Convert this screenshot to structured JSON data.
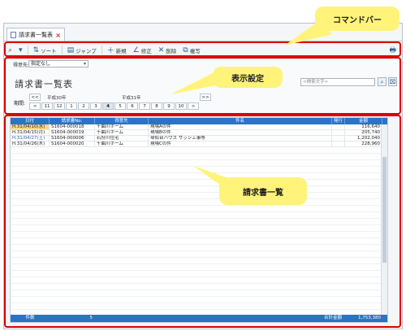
{
  "tab": {
    "title": "請求書一覧表",
    "close": "×"
  },
  "toolbar": {
    "items": [
      {
        "icon": "search-icon",
        "glyph": "⌕",
        "label": ""
      },
      {
        "icon": "dropdown-icon",
        "glyph": "▾",
        "label": ""
      },
      {
        "icon": "sort-icon",
        "glyph": "⇅",
        "label": "ソート"
      },
      {
        "icon": "jump-icon",
        "glyph": "▤",
        "label": "ジャンプ"
      },
      {
        "icon": "new-icon",
        "glyph": "＋",
        "label": "新規"
      },
      {
        "icon": "edit-icon",
        "glyph": "∠",
        "label": "修正"
      },
      {
        "icon": "delete-icon",
        "glyph": "✕",
        "label": "削除"
      },
      {
        "icon": "copy-icon",
        "glyph": "⧉",
        "label": "複写"
      }
    ],
    "print_icon": "🖶"
  },
  "settings": {
    "client_label": "得意先:",
    "client_value": "指定なし",
    "page_title": "請求書一覧表",
    "search_placeholder": "<検索文字>",
    "period_label": "期間:",
    "era_left": "平成30年",
    "era_right": "平成31年",
    "months": [
      "11",
      "12",
      "1",
      "2",
      "3",
      "4",
      "5",
      "6",
      "7",
      "8",
      "9",
      "10"
    ],
    "selected_month": "4",
    "prev": "<<",
    "prev1": "<",
    "next": ">>"
  },
  "grid": {
    "headers": [
      "日付",
      "請求書No.",
      "得意先",
      "件名",
      "発行",
      "金額"
    ],
    "rows": [
      [
        "H.31/04/10(水)",
        "S1604-000018",
        "千曲川ホーム",
        "現場Aの件",
        "",
        "116,640"
      ],
      [
        "H.31/04/15(月)",
        "S1604-000019",
        "千曲川ホーム",
        "現場Bの件",
        "",
        "205,740"
      ],
      [
        "H.31/04/27(土)",
        "S1604-000006",
        "石狩川住宅",
        "琴似台ハウス サッシ工事等",
        "",
        "1,202,040"
      ],
      [
        "H.31/04/26(木)",
        "S1604-000020",
        "千曲川ホーム",
        "現場Cの件",
        "",
        "228,960"
      ]
    ],
    "footer_count_label": "件数",
    "footer_count": "5",
    "footer_total_label": "合計金額",
    "footer_total": "1,753,380"
  },
  "callouts": {
    "command_bar": "コマンドバー",
    "display_settings": "表示設定",
    "invoice_list": "請求書一覧"
  }
}
